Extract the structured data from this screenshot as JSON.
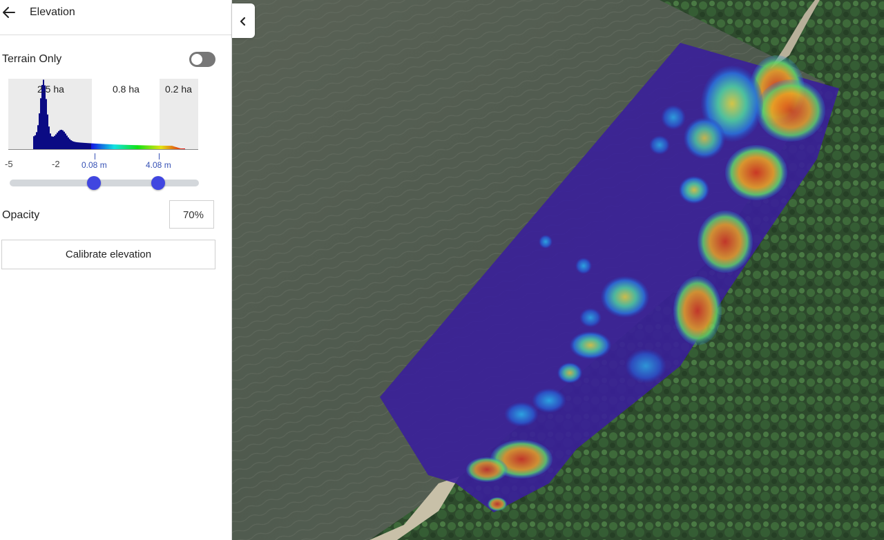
{
  "header": {
    "title": "Elevation",
    "back_icon": "arrow-left-icon"
  },
  "terrain_only": {
    "label": "Terrain Only",
    "enabled": false
  },
  "histogram": {
    "areas": [
      "2.5 ha",
      "0.8 ha",
      "0.2 ha"
    ],
    "axis_ticks": [
      "-5",
      "-2"
    ],
    "range_markers": [
      "0.08 m",
      "4.08 m"
    ]
  },
  "elevation_range": {
    "min": "0.08 m",
    "max": "4.08 m"
  },
  "opacity": {
    "label": "Opacity",
    "value": "70%"
  },
  "calibrate": {
    "label": "Calibrate elevation"
  },
  "collapse_icon": "chevron-left-icon",
  "colors": {
    "accent": "#4046e0",
    "marker": "#3550b5",
    "overlay_low": "#3a1f9a",
    "overlay_high": "#d83a18"
  }
}
